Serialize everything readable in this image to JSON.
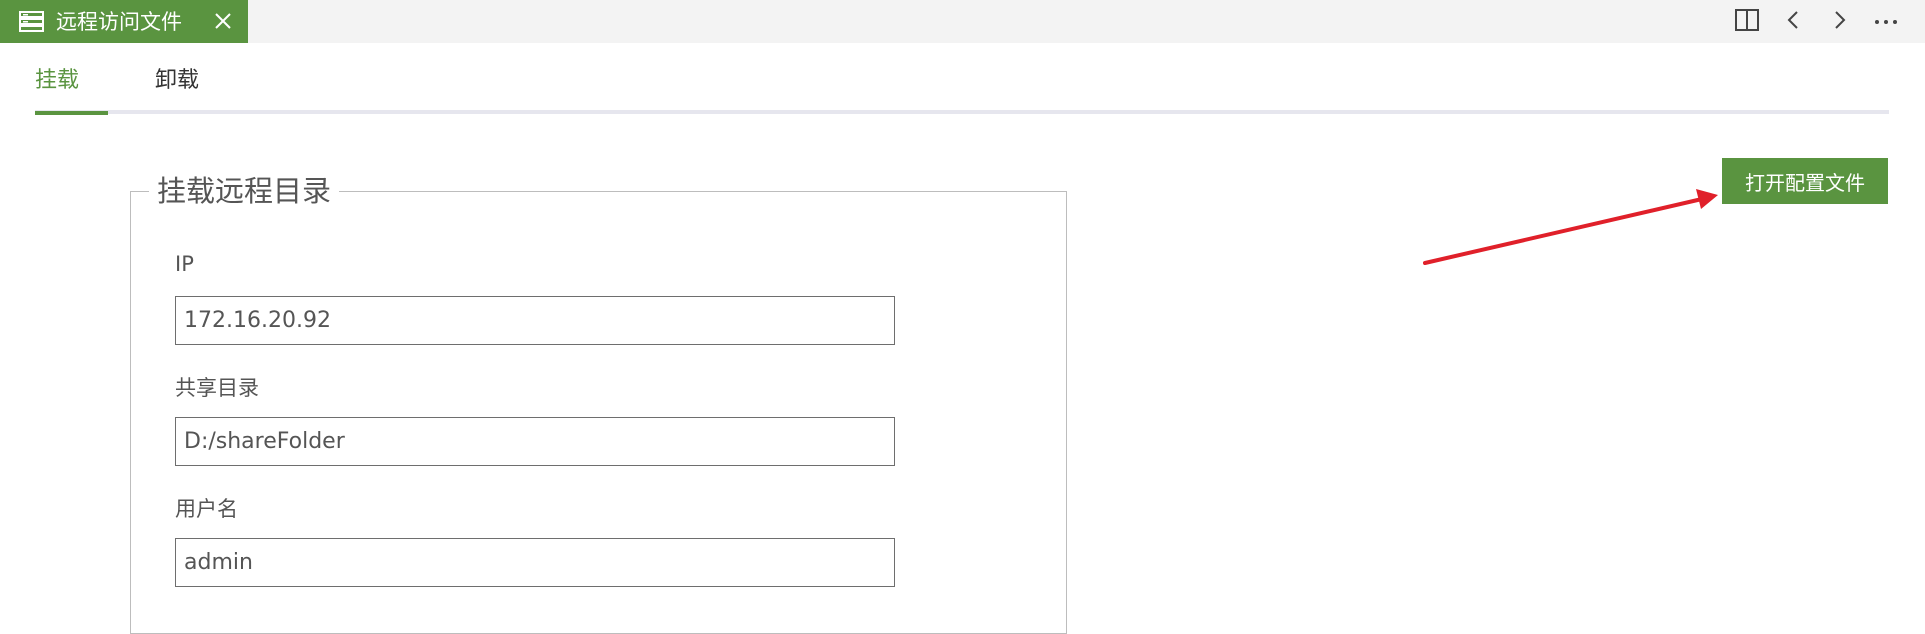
{
  "window": {
    "tab_title": "远程访问文件",
    "tab_icon": "server-list-icon",
    "close_icon": "close-icon",
    "actions": [
      {
        "name": "split-editor-icon"
      },
      {
        "name": "back-chevron-icon"
      },
      {
        "name": "forward-chevron-icon"
      },
      {
        "name": "more-ellipsis-icon"
      }
    ]
  },
  "subtabs": {
    "mount": "挂载",
    "unmount": "卸载",
    "active": "mount"
  },
  "mount_form": {
    "legend": "挂载远程目录",
    "fields": [
      {
        "label": "IP",
        "value": "172.16.20.92"
      },
      {
        "label": "共享目录",
        "value": "D:/shareFolder"
      },
      {
        "label": "用户名",
        "value": "admin"
      }
    ]
  },
  "actions": {
    "open_config": "打开配置文件"
  },
  "colors": {
    "accent": "#5a9440",
    "annotation_arrow": "#e0202a",
    "tab_rail": "#e6e6ee"
  }
}
